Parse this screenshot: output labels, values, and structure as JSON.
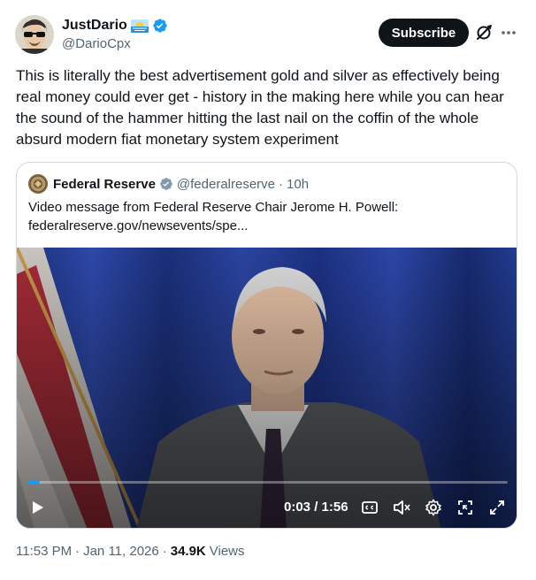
{
  "author": {
    "name": "JustDario",
    "handle": "@DarioCpx"
  },
  "actions": {
    "subscribe_label": "Subscribe"
  },
  "tweet": {
    "text": "This is literally the best advertisement gold and silver as effectively being real money could ever get - history in the making here while you can hear the sound of the hammer hitting the last nail on the coffin of the whole absurd modern fiat monetary system experiment"
  },
  "quote": {
    "name": "Federal Reserve",
    "handle": "@federalreserve",
    "separator": "·",
    "age": "10h",
    "text_line1": "Video message from Federal Reserve Chair Jerome H. Powell:",
    "text_line2": "federalreserve.gov/newsevents/spe..."
  },
  "video": {
    "time": "0:03 / 1:56",
    "progress": 0.026
  },
  "meta": {
    "time": "11:53 PM",
    "sep1": "·",
    "date": "Jan 11, 2026",
    "sep2": "·",
    "views_count": "34.9K",
    "views_label": "Views"
  },
  "colors": {
    "accent": "#1d9bf0",
    "text_primary": "#0f1419",
    "text_secondary": "#536471",
    "border": "#cfd9de"
  },
  "icons": [
    "sunglasses-avatar",
    "sunrise-emoji",
    "verified-badge-icon",
    "grok-icon",
    "more-icon",
    "play-icon",
    "captions-icon",
    "mute-icon",
    "settings-icon",
    "pip-icon",
    "fullscreen-icon"
  ]
}
